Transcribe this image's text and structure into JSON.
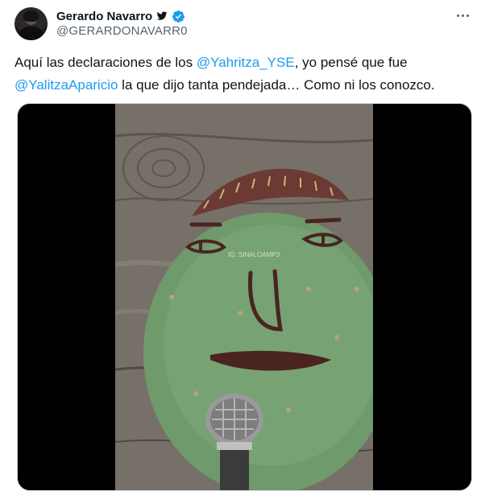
{
  "author": {
    "display_name": "Gerardo Navarro",
    "handle": "@GERARDONAVARR0"
  },
  "tweet": {
    "text_before": "Aquí las declaraciones de los ",
    "mention_1": "@Yahritza_YSE",
    "text_middle": ", yo pensé que fue ",
    "mention_2": "@YalitzaAparicio",
    "text_after": " la que dijo tanta pendejada… Como ni los conozco."
  },
  "media": {
    "watermark": "IG: SINALOAMP3"
  },
  "icons": [
    "twitter-bird-icon",
    "verified-badge-icon",
    "more-options-icon",
    "microphone"
  ],
  "colors": {
    "accent": "#1d9bf0",
    "text": "#0f1419",
    "secondary": "#536471",
    "cactus": "#6f9a6c"
  }
}
